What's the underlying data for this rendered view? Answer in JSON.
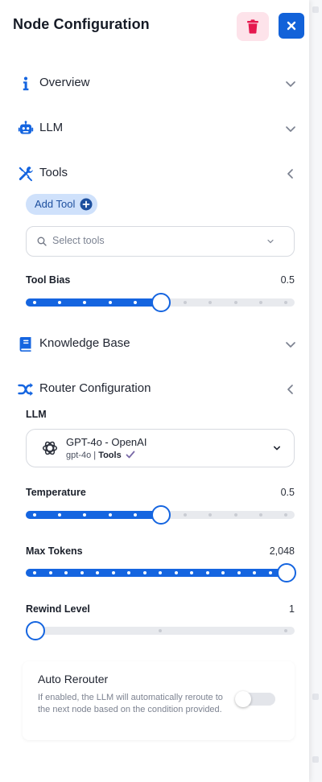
{
  "header": {
    "title": "Node Configuration",
    "delete_icon": "trash-icon",
    "close_icon": "close-icon"
  },
  "sections": {
    "overview": {
      "label": "Overview",
      "icon": "info-icon",
      "expanded": false
    },
    "llm": {
      "label": "LLM",
      "icon": "robot-icon",
      "expanded": false
    },
    "tools": {
      "label": "Tools",
      "icon": "tools-icon",
      "expanded": true
    },
    "knowledge_base": {
      "label": "Knowledge Base",
      "icon": "book-icon",
      "expanded": false
    },
    "router_configuration": {
      "label": "Router Configuration",
      "icon": "shuffle-icon",
      "expanded": true
    }
  },
  "tools": {
    "add_tool_label": "Add Tool",
    "select_placeholder": "Select tools",
    "tool_bias": {
      "label": "Tool Bias",
      "value": "0.5",
      "fraction": 0.5,
      "steps": 10
    }
  },
  "router": {
    "llm_label": "LLM",
    "model": {
      "name": "GPT-4o - OpenAI",
      "id": "gpt-4o",
      "capability": "Tools"
    },
    "temperature": {
      "label": "Temperature",
      "value": "0.5",
      "fraction": 0.5,
      "steps": 10
    },
    "max_tokens": {
      "label": "Max Tokens",
      "value": "2,048",
      "fraction": 1.0,
      "steps": 16
    },
    "rewind_level": {
      "label": "Rewind Level",
      "value": "1",
      "fraction": 0.0,
      "steps": 2
    },
    "auto_rerouter": {
      "title": "Auto Rerouter",
      "description": "If enabled, the LLM will automatically reroute to the next node based on the condition provided.",
      "enabled": false
    }
  },
  "colors": {
    "accent": "#1565e0",
    "delete_bg": "#fde3ea",
    "delete_icon": "#e5194f"
  }
}
